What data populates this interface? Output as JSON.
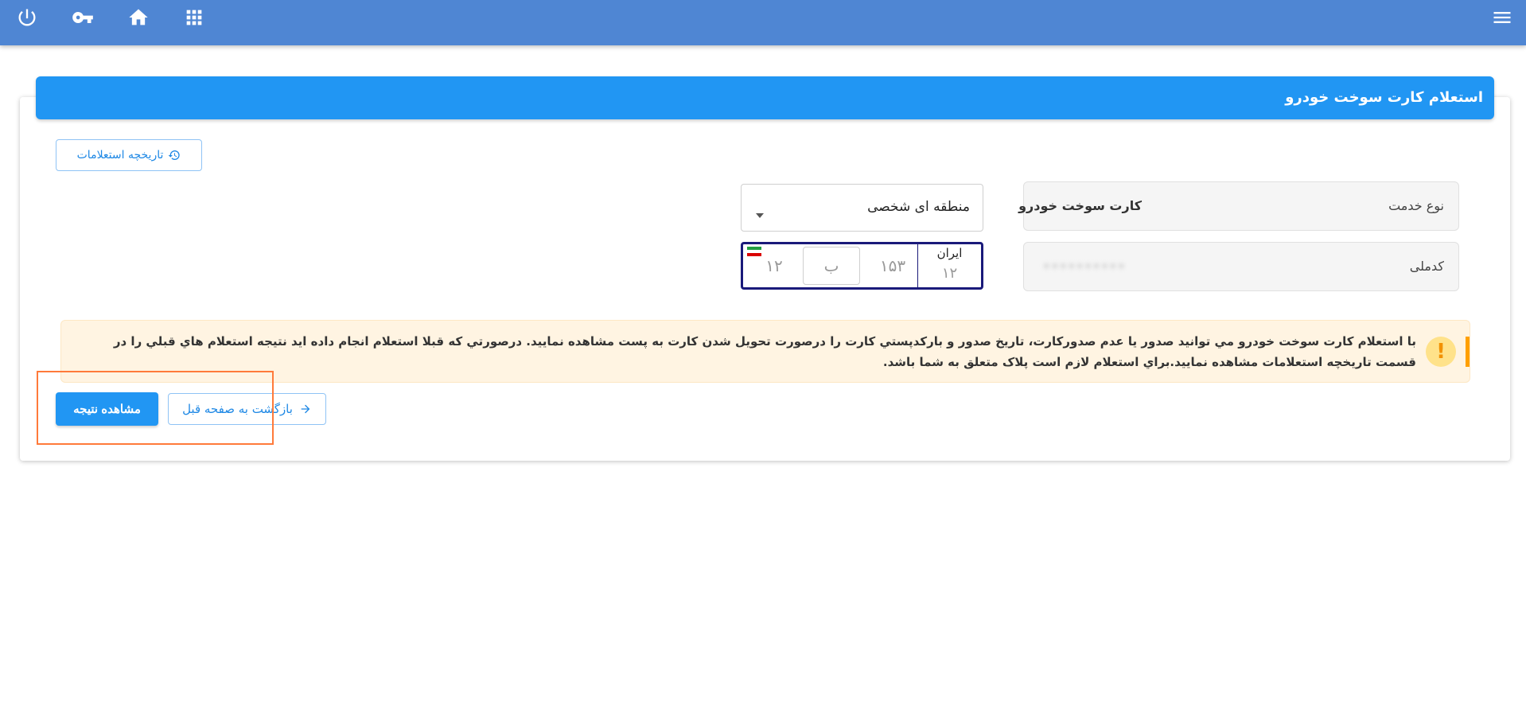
{
  "topbar": {
    "icons": [
      "power-icon",
      "key-icon",
      "home-icon",
      "apps-grid-icon",
      "menu-icon"
    ]
  },
  "card": {
    "title": "استعلام کارت سوخت خودرو",
    "history_button": "تاریخچه استعلامات"
  },
  "fields": {
    "service_label": "نوع خدمت",
    "service_value": "کارت سوخت خودرو",
    "national_id_label": "کدملی",
    "national_id_value": "••••••••••"
  },
  "plate_type": {
    "selected": "منطقه ای شخصی"
  },
  "plate": {
    "iran_label": "ایران",
    "iran_number": "۱۲",
    "three_digits": "۱۵۳",
    "letter": "ب",
    "two_digits": "۱۲"
  },
  "alert": {
    "text": "با استعلام کارت سوخت خودرو مي توانيد صدور يا عدم صدورکارت، تاريخ صدور و بارکدپستي کارت را درصورت تحويل شدن کارت به پست مشاهده نماييد. درصورتي که قبلا استعلام انجام داده ايد نتيجه استعلام هاي قبلي را در قسمت تاريخچه استعلامات مشاهده نماييد.براي استعلام لازم است پلاک متعلق به شما باشد.",
    "icon": "warning-icon"
  },
  "buttons": {
    "view_result": "مشاهده نتیجه",
    "back": "بازگشت به صفحه قبل"
  },
  "colors": {
    "topbar": "#4f86d3",
    "header": "#2196f3",
    "alert_bg": "#fff4e2",
    "alert_accent": "#ffa000",
    "highlight": "#ff7a3a"
  }
}
